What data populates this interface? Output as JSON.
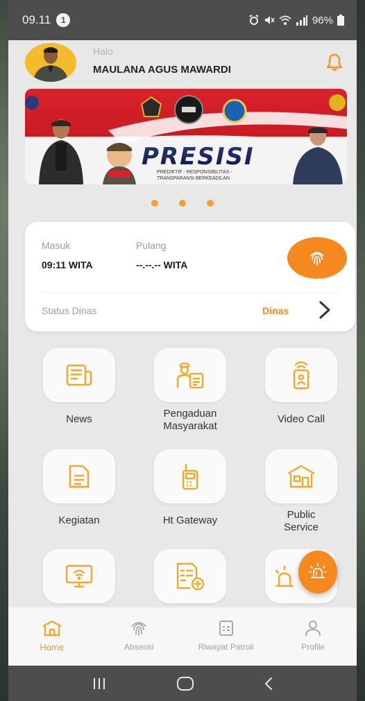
{
  "status_bar": {
    "time": "09.11",
    "notification_count": "1",
    "battery": "96%"
  },
  "header": {
    "greeting": "Halo",
    "user_name": "MAULANA AGUS MAWARDI"
  },
  "banner": {
    "title": "PRESISI",
    "tagline_line1": "PREDIKTIF - RESPONSIBILITAS -",
    "tagline_line2": "TRANSPARANSI BERKEADILAN"
  },
  "carousel": {
    "dots": 3
  },
  "attendance": {
    "masuk_label": "Masuk",
    "masuk_value": "09:11 WITA",
    "pulang_label": "Pulang",
    "pulang_value": "--.--.-- WITA",
    "status_label": "Status Dinas",
    "status_value": "Dinas"
  },
  "menu": [
    {
      "label": "News",
      "icon": "news-icon"
    },
    {
      "label": "Pengaduan Masyarakat",
      "icon": "complaint-icon"
    },
    {
      "label": "Video Call",
      "icon": "video-call-icon"
    },
    {
      "label": "Kegiatan",
      "icon": "activity-document-icon"
    },
    {
      "label": "Ht Gateway",
      "icon": "walkie-talkie-icon"
    },
    {
      "label": "Public Service",
      "icon": "public-service-icon"
    },
    {
      "label": "",
      "icon": "monitor-wifi-icon"
    },
    {
      "label": "",
      "icon": "add-report-icon"
    },
    {
      "label": "",
      "icon": "siren-icon"
    }
  ],
  "bottom_nav": [
    {
      "label": "Home",
      "icon": "home-icon",
      "active": true
    },
    {
      "label": "Absensi",
      "icon": "fingerprint-icon",
      "active": false
    },
    {
      "label": "Riwayat Patroli",
      "icon": "document-icon",
      "active": false
    },
    {
      "label": "Profile",
      "icon": "user-icon",
      "active": false
    }
  ],
  "colors": {
    "accent": "#f5881f",
    "icon": "#f0a92c",
    "status_value": "#f08a1c"
  }
}
